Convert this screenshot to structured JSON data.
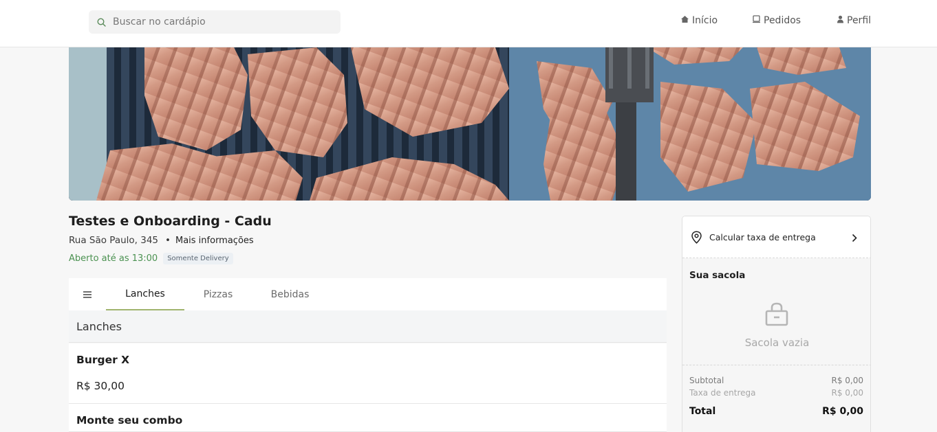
{
  "header": {
    "search": {
      "placeholder": "Buscar no cardápio"
    },
    "nav": [
      {
        "label": "Início",
        "icon": "home-icon"
      },
      {
        "label": "Pedidos",
        "icon": "receipt-icon"
      },
      {
        "label": "Perfil",
        "icon": "user-icon"
      }
    ]
  },
  "store": {
    "name": "Testes e Onboarding - Cadu",
    "address": "Rua São Paulo, 345",
    "more_info": "Mais informações",
    "status": "Aberto até as 13:00",
    "badge": "Somente Delivery"
  },
  "tabs": [
    {
      "label": "Lanches",
      "active": true
    },
    {
      "label": "Pizzas",
      "active": false
    },
    {
      "label": "Bebidas",
      "active": false
    }
  ],
  "menu": {
    "section_title": "Lanches",
    "items": [
      {
        "name": "Burger X",
        "price": "R$ 30,00"
      },
      {
        "name": "Monte seu combo"
      }
    ]
  },
  "cart": {
    "delivery_label": "Calcular taxa de entrega",
    "title": "Sua sacola",
    "empty_text": "Sacola vazia",
    "subtotal_label": "Subtotal",
    "subtotal_value": "R$ 0,00",
    "fee_label": "Taxa de entrega",
    "fee_value": "R$ 0,00",
    "total_label": "Total",
    "total_value": "R$ 0,00"
  },
  "colors": {
    "accent_green": "#4a9150",
    "tab_underline": "#a0b46e"
  }
}
